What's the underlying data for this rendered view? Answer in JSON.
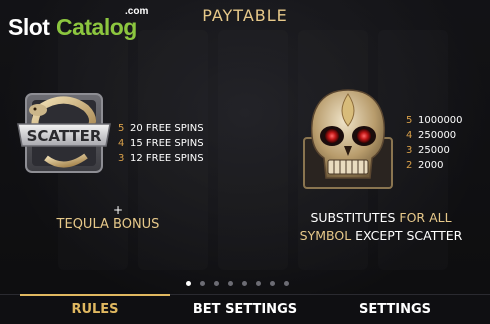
{
  "watermark": {
    "slot": "Slot",
    "catalog": "Catalog",
    "com": ".com"
  },
  "title": "PAYTABLE",
  "scatter": {
    "symbol_text": "SCATTER",
    "pays": [
      {
        "count": "5",
        "value": "20 FREE SPINS"
      },
      {
        "count": "4",
        "value": "15 FREE SPINS"
      },
      {
        "count": "3",
        "value": "12 FREE SPINS"
      }
    ],
    "plus": "+",
    "bonus": "TEQULA BONUS"
  },
  "wild": {
    "pays": [
      {
        "count": "5",
        "value": "1000000"
      },
      {
        "count": "4",
        "value": "250000"
      },
      {
        "count": "3",
        "value": "25000"
      },
      {
        "count": "2",
        "value": "2000"
      }
    ],
    "substitutes": {
      "w1": "SUBSTITUTES",
      "g1": " FOR ALL",
      "w2": "SYMBOL",
      "g2": " EXCEPT SCATTER"
    }
  },
  "pagination": {
    "count": 8,
    "active_index": 0
  },
  "tabs": [
    {
      "label": "RULES",
      "active": true
    },
    {
      "label": "BET SETTINGS",
      "active": false
    },
    {
      "label": "SETTINGS",
      "active": false
    }
  ],
  "colors": {
    "gold": "#e7c98a",
    "accent": "#e0b860",
    "pay_number": "#d9a04a",
    "watermark_green": "#8cc63f"
  }
}
